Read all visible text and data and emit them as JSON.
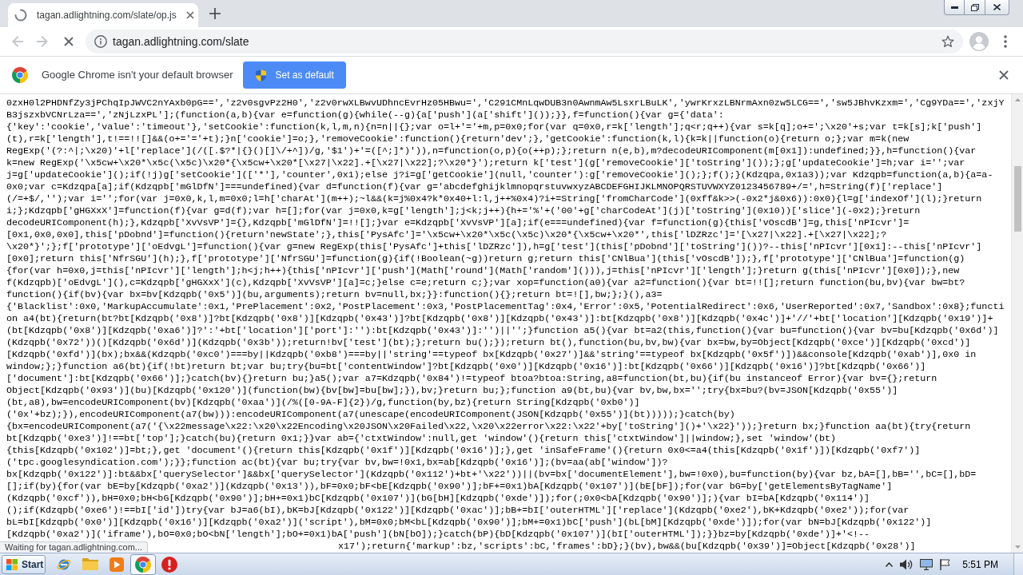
{
  "browser": {
    "tabs": [
      {
        "title": "tagan.adlightning.com/slate/op.js",
        "selected": true
      }
    ],
    "loading": true,
    "nav_buttons": [
      {
        "kind": "back",
        "disabled": true
      },
      {
        "kind": "forward",
        "disabled": true
      }
    ],
    "url": "tagan.adlightning.com/slate",
    "starred": false
  },
  "infobar": {
    "message": "Google Chrome isn't your default browser",
    "button": "Set as default"
  },
  "document": {
    "lines": [
      "0zxH0l2PHDNfZy3jPChqIpJWVC2nYAxb0pG==','z2v0sgvPz2H0','z2v0rwXLBwvUDhncEvrHz05HBwu=','C291CMnLqwDUB3n0AwnmAw5LsxrLBuLK','ywrKrxzLBNrmAxn0zw5LCG==','sw5JBhvKzxm=','Cg9YDa==','zxjY",
      "B3jszxbVCNrLza==','zNjLzxPL'];(function(a,b){var e=function(g){while(--g){a['push'](a['shift']());}},f=function(){var g={'data':",
      "{'key':'cookie','value':'timeout'},'setCookie':function(k,l,m,n){n=n||{};var o=l+'='+m,p=0x0;for(var q=0x0,r=k['length'];q<r;q++){var s=k[q];o+=';\\x20'+s;var t=k[s];k['push']",
      "(t),r=k['length'],t!==!![]&&(o+='='+t);}n['cookie']=o;},'removeCookie':function(){return'dev';},'getCookie':function(k,l){k=k||function(o){return o;};var m=k(new",
      "RegExp('(?:^|;\\x20)'+l['replace'](/([.$?*|{}()[]\\/+^])/g,'$1')+'=([^;]*)')),n=function(o,p){o(++p);};return n(e,b),m?decodeURIComponent(m[0x1]):undefined;}},h=function(){var",
      "k=new RegExp('\\x5cw+\\x20*\\x5c(\\x5c)\\x20*{\\x5cw+\\x20*[\\x27|\\x22].+[\\x27|\\x22];?\\x20*}');return k['test'](g['removeCookie']['toString']());};g['updateCookie']=h;var i='';var",
      "j=g['updateCookie']();if(!j)g['setCookie'](['*'],'counter',0x1);else j?i=g['getCookie'](null,'counter'):g['removeCookie']();};f();}(Kdzqpa,0x1a3));var Kdzqpb=function(a,b){a=a-",
      "0x0;var c=Kdzqpa[a];if(Kdzqpb['mGlDfN']===undefined){var d=function(f){var g='abcdefghijklmnopqrstuvwxyzABCDEFGHIJKLMNOPQRSTUVWXYZ0123456789+/=',h=String(f)['replace']",
      "(/=+$/,'');var i='';for(var j=0x0,k,l,m=0x0;l=h['charAt'](m++);~l&&(k=j%0x4?k*0x40+l:l,j++%0x4)?i+=String['fromCharCode'](0xff&k>>(-0x2*j&0x6)):0x0){l=g['indexOf'](l);}return",
      "i;};Kdzqpb['gHGXxX']=function(f){var g=d(f);var h=[];for(var j=0x0,k=g['length'];j<k;j++){h+='%'+('00'+g['charCodeAt'](j)['toString'](0x10))['slice'](-0x2);}return",
      "decodeURIComponent(h);},Kdzqpb['XvVsVP']={},Kdzqpb['mGlDfN']=!![];}var e=Kdzqpb['XvVsVP'][a];if(e===undefined){var f=function(g){this['vOscdB']=g,this['nPIcvr']=",
      "[0x1,0x0,0x0],this['pDobnd']=function(){return'newState';},this['PysAfc']='\\x5cw+\\x20*\\x5c(\\x5c)\\x20*{\\x5cw+\\x20*',this['lDZRzc']='[\\x27|\\x22].+[\\x27|\\x22];?",
      "\\x20*}';};f['prototype']['oEdvgL']=function(){var g=new RegExp(this['PysAfc']+this['lDZRzc']),h=g['test'](this['pDobnd']['toString']())?--this['nPIcvr'][0x1]:--this['nPIcvr']",
      "[0x0];return this['NfrSGU'](h);},f['prototype']['NfrSGU']=function(g){if(!Boolean(~g))return g;return this['CNlBua'](this['vOscdB']);},f['prototype']['CNlBua']=function(g)",
      "{for(var h=0x0,j=this['nPIcvr']['length'];h<j;h++){this['nPIcvr']['push'](Math['round'](Math['random']())),j=this['nPIcvr']['length'];}return g(this['nPIcvr'][0x0]);},new",
      "f(Kdzqpb)['oEdvgL'](),c=Kdzqpb['gHGXxX'](c),Kdzqpb['XvVsVP'][a]=c;}else c=e;return c;};var xop=function(a0){var a2=function(){var bt=!![];return function(bu,bv){var bw=bt?",
      "function(){if(bv){var bx=bv[Kdzqpb('0x5')](bu,arguments);return bv=null,bx;}}:function(){};return bt=![],bw;};}(),a3=",
      "{'Blacklist':0x0,'MarkupAccumulate':0x1,'PrePlacement':0x2,'PostPlacement':0x3,'PostPlacementTag':0x4,'Error':0x5,'PotentialRedirect':0x6,'UserReported':0x7,'Sandbox':0x8};functi",
      "on a4(bt){return(bt?bt[Kdzqpb('0x8')]?bt[Kdzqpb('0x8')][Kdzqpb('0x43')]?bt[Kdzqpb('0x8')][Kdzqpb('0x43')]:bt[Kdzqpb('0x8')][Kdzqpb('0x4c')]+'//'+bt['location'][Kdzqpb('0x19')]+",
      "(bt[Kdzqpb('0x8')][Kdzqpb('0xa6')]?':'+bt['location']['port']:''):bt[Kdzqpb('0x43')]:'')||'';}function a5(){var bt=a2(this,function(){var bu=function(){var bv=bu[Kdzqpb('0x6d')]",
      "(Kdzqpb('0x72'))()[Kdzqpb('0x6d')](Kdzqpb('0x3b'));return!bv['test'](bt);};return bu();});return bt(),function(bu,bv,bw){var bx=bw,by=Object[Kdzqpb('0xce')][Kdzqpb('0xcd')]",
      "[Kdzqpb('0xfd')](bx);bx&&(Kdzqpb('0xc0')===by||Kdzqpb('0xb8')===by||'string'==typeof bx[Kdzqpb('0x27')]&&'string'==typeof bx[Kdzqpb('0x5f')])&&console[Kdzqpb('0xab')],0x0 in",
      "window;};}function a6(bt){if(!bt)return bt;var bu;try{bu=bt['contentWindow']?bt[Kdzqpb('0x0')][Kdzqpb('0x16')]:bt[Kdzqpb('0x66')][Kdzqpb('0x16')]?bt[Kdzqpb('0x66')]",
      "['document']:bt[Kdzqpb('0x66')];}catch(bv){}return bu;}a5();var a7=Kdzqpb('0x84')!=typeof btoa?btoa:String,a8=function(bt,bu){if(bu instanceof Error){var bv={};return",
      "Object[Kdzqpb('0x93')](bu)[Kdzqpb('0x120')](function(bw){bv[bw]=bu[bw];}),bv;}return bu;};function a9(bt,bu){var bv,bw,bx='';try{bx=bu?(bv=JSON[Kdzqpb('0x55')]",
      "(bt,a8),bw=encodeURIComponent(bv)[Kdzqpb('0xaa')](/%([0-9A-F]{2})/g,function(by,bz){return String[Kdzqpb('0xb0')]",
      "('0x'+bz);}),encodeURIComponent(a7(bw))):encodeURIComponent(a7(unescape(encodeURIComponent(JSON[Kdzqpb('0x55')](bt)))));}catch(by)",
      "{bx=encodeURIComponent(a7('{\\x22message\\x22:\\x20\\x22Encoding\\x20JSON\\x20Failed\\x22,\\x20\\x22error\\x22:\\x22'+by['toString']()+'\\x22}'));}return bx;}function aa(bt){try{return",
      "bt[Kdzqpb('0xe3')]!==bt['top'];}catch(bu){return 0x1;}}var ab={'ctxtWindow':null,get 'window'(){return this['ctxtWindow']||window;},set 'window'(bt)",
      "{this[Kdzqpb('0x102')]=bt;},get 'document'(){return this[Kdzqpb('0x1f')][Kdzqpb('0x16')];},get 'inSafeFrame'(){return 0x0<=a4(this[Kdzqpb('0x1f')])[Kdzqpb('0xf7')]",
      "('tpc.googlesyndication.com');}};function ac(bt){var bu;try{var bv,bw=!0x1,bx=ab[Kdzqpb('0x16')];(bv=aa(ab['window'])?",
      "bx[Kdzqpb('0x122')]:bt&&bx['querySelector']&&bx['querySelector'](Kdzqpb('0x112')+bt+'\\x22'))||(bv=bx['documentElement'],bw=!0x0),bu=function(by){var bz,bA=[],bB='',bC=[],bD=",
      "[];if(by){for(var bE=by[Kdzqpb('0xa2')](Kdzqpb('0x13')),bF=0x0;bF<bE[Kdzqpb('0x90')];bF+=0x1)bA[Kdzqpb('0x107')](bE[bF]);for(var bG=by['getElementsByTagName']",
      "(Kdzqpb('0xcf')),bH=0x0;bH<bG[Kdzqpb('0x90')];bH+=0x1)bC[Kdzqpb('0x107')](bG[bH][Kdzqpb('0xde')]);for(;0x0<bA[Kdzqpb('0x90')];){var bI=bA[Kdzqpb('0x114')]",
      "();if(Kdzqpb('0xe6')!==bI['id'])try{var bJ=a6(bI),bK=bJ[Kdzqpb('0x122')][Kdzqpb('0xac')];bB+=bI['outerHTML']['replace'](Kdzqpb('0xe2'),bK+Kdzqpb('0xe2'));for(var",
      "bL=bI[Kdzqpb('0x0')][Kdzqpb('0x16')][Kdzqpb('0xa2')]('script'),bM=0x0;bM<bL[Kdzqpb('0x90')];bM+=0x1)bC['push'](bL[bM][Kdzqpb('0xde')]);for(var bN=bJ[Kdzqpb('0x122')]",
      "[Kdzqpb('0xa2')]('iframe'),bO=0x0;bO<bN['length'];bO+=0x1)bA['push'](bN[bO]);}catch(bP){bD[Kdzqpb('0x107')](bI['outerHTML']);}}bz=by[Kdzqpb('0xde')]+'<!--"
    ],
    "partial_line": "x17');return{'markup':bz,'scripts':bC,'frames':bD};}(bv),bw&&(bu[Kdzqpb('0x39')]=Object[Kdzqpb('0x28')]"
  },
  "status_bubble": "Waiting for tagan.adlightning.com...",
  "taskbar": {
    "start": "Start",
    "apps": [
      {
        "kind": "explorer",
        "selected": false
      },
      {
        "kind": "folder",
        "selected": false
      },
      {
        "kind": "player",
        "selected": false
      },
      {
        "kind": "browser",
        "selected": true
      },
      {
        "kind": "alert",
        "selected": false
      }
    ],
    "clock": "5:51 PM"
  }
}
